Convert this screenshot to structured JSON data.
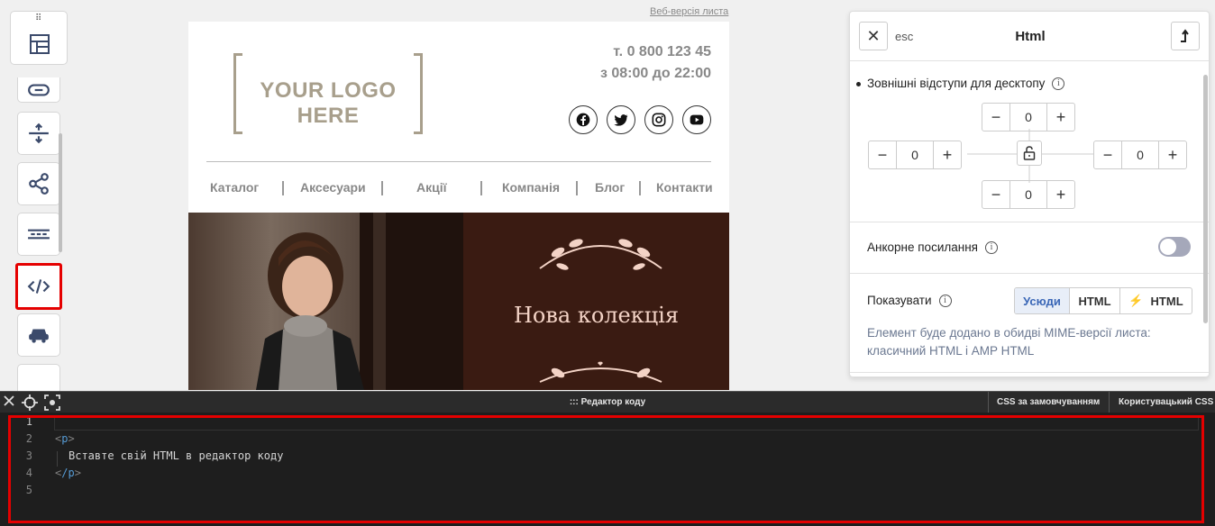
{
  "toolbar": {
    "drag_handle": "⠿",
    "blocks": [
      {
        "name": "button-block",
        "icon": "button-icon"
      },
      {
        "name": "spacer-block",
        "icon": "spacer-icon"
      },
      {
        "name": "social-block",
        "icon": "share-icon"
      },
      {
        "name": "menu-block",
        "icon": "menu-icon"
      },
      {
        "name": "html-block",
        "icon": "code-icon",
        "active": true
      },
      {
        "name": "video-block",
        "icon": "video-icon"
      }
    ]
  },
  "email": {
    "web_version_link": "Веб-версія листа",
    "logo_text": "YOUR LOGO HERE",
    "phone": "т. 0 800 123 45",
    "hours": "з 08:00 до 22:00",
    "socials": [
      "facebook-icon",
      "twitter-icon",
      "instagram-icon",
      "youtube-icon"
    ],
    "nav": [
      "Каталог",
      "Аксесуари",
      "Акції",
      "Компанія",
      "Блог",
      "Контакти"
    ],
    "hero_title": "Нова колекція"
  },
  "panel": {
    "esc_label": "esc",
    "title": "Html",
    "margins_label": "Зовнішні відступи для десктопу",
    "margin_top": "0",
    "margin_left": "0",
    "margin_right": "0",
    "margin_bottom": "0",
    "anchor_label": "Анкорне посилання",
    "anchor_enabled": false,
    "show_label": "Показувати",
    "show_options": [
      "Усюди",
      "HTML",
      "HTML"
    ],
    "show_selected": "Усюди",
    "note": "Елемент буде додано в обидві MIME-версії листа: класичний HTML і AMP HTML"
  },
  "code_editor": {
    "title": "::: Редактор коду",
    "tab_default_css": "CSS за замовчуванням",
    "tab_custom_css": "Користувацький CSS",
    "line_numbers": [
      "1",
      "2",
      "3",
      "4",
      "5"
    ],
    "lines": [
      "",
      "<p>",
      "  Вставте свій HTML в редактор коду",
      "</p>",
      ""
    ],
    "tag_open": "p",
    "text": "Вставте свій HTML в редактор коду",
    "tag_close": "/p"
  },
  "colors": {
    "highlight": "#e50000",
    "accent_blue": "#3a67b7",
    "editor_bg": "#1e1e1e"
  }
}
